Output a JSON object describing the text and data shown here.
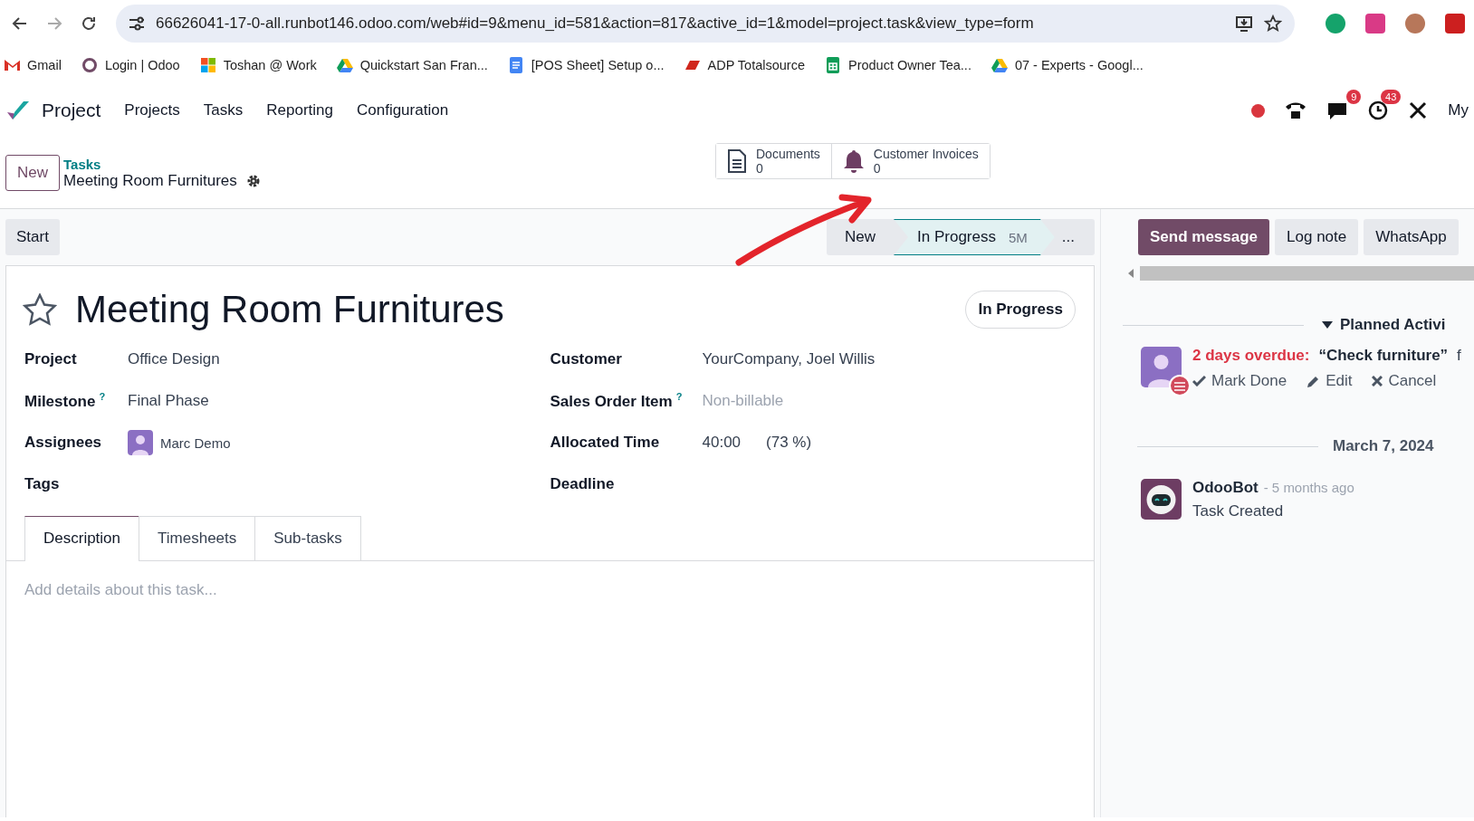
{
  "browser": {
    "url": "66626041-17-0-all.runbot146.odoo.com/web#id=9&menu_id=581&action=817&active_id=1&model=project.task&view_type=form",
    "bookmarks": [
      {
        "label": "Gmail",
        "kind": "mail"
      },
      {
        "label": "Login | Odoo",
        "kind": "ring"
      },
      {
        "label": "Toshan @ Work",
        "kind": "tiles"
      },
      {
        "label": "Quickstart San Fran...",
        "kind": "drive"
      },
      {
        "label": "[POS Sheet] Setup o...",
        "kind": "doc"
      },
      {
        "label": "ADP Totalsource",
        "kind": "adp"
      },
      {
        "label": "Product Owner Tea...",
        "kind": "sheet"
      },
      {
        "label": "07 - Experts - Googl...",
        "kind": "drive"
      }
    ]
  },
  "navbar": {
    "app": "Project",
    "menu": [
      "Projects",
      "Tasks",
      "Reporting",
      "Configuration"
    ],
    "messages_badge": "9",
    "activities_badge": "43",
    "user": "My"
  },
  "control_panel": {
    "new_button": "New",
    "breadcrumb": "Tasks",
    "record": "Meeting Room Furnitures",
    "smart_buttons": [
      {
        "label": "Documents",
        "count": "0",
        "kind": "document"
      },
      {
        "label": "Customer Invoices",
        "count": "0",
        "kind": "bell"
      }
    ]
  },
  "action_bar": {
    "start": "Start",
    "stages": [
      {
        "label": "New",
        "selected": false
      },
      {
        "label": "In Progress",
        "duration": "5M",
        "selected": true
      }
    ],
    "more": "..."
  },
  "chatter_buttons": [
    {
      "label": "Send message",
      "primary": true
    },
    {
      "label": "Log note",
      "primary": false
    },
    {
      "label": "WhatsApp",
      "primary": false
    }
  ],
  "form": {
    "title": "Meeting Room Furnitures",
    "starred": false,
    "stage_badge": "In Progress",
    "fields_left": [
      {
        "label": "Project",
        "kind": "text",
        "value": "Office Design"
      },
      {
        "label": "Milestone",
        "help": "?",
        "kind": "text",
        "value": "Final Phase"
      },
      {
        "label": "Assignees",
        "kind": "avatar",
        "value": "Marc Demo"
      },
      {
        "label": "Tags",
        "kind": "empty"
      }
    ],
    "fields_right": [
      {
        "label": "Customer",
        "kind": "text",
        "value": "YourCompany, Joel Willis"
      },
      {
        "label": "Sales Order Item",
        "help": "?",
        "kind": "placeholder",
        "placeholder": "Non-billable"
      },
      {
        "label": "Allocated Time",
        "kind": "time",
        "value": "40:00",
        "extra": "(73 %)"
      },
      {
        "label": "Deadline",
        "kind": "empty"
      }
    ],
    "tabs": [
      {
        "label": "Description",
        "selected": true
      },
      {
        "label": "Timesheets",
        "selected": false
      },
      {
        "label": "Sub-tasks",
        "selected": false
      }
    ],
    "placeholder": "Add details about this task..."
  },
  "chatter": {
    "activities_header": "Planned Activi",
    "activity": {
      "overdue": "2 days overdue:",
      "summary": "“Check furniture”",
      "trailing": "f",
      "actions": [
        {
          "label": "Mark Done",
          "kind": "check"
        },
        {
          "label": "Edit",
          "kind": "pencil"
        },
        {
          "label": "Cancel",
          "kind": "cross"
        }
      ]
    },
    "date": "March 7, 2024",
    "message": {
      "author": "OdooBot",
      "time": "- 5 months ago",
      "body": "Task Created"
    }
  }
}
